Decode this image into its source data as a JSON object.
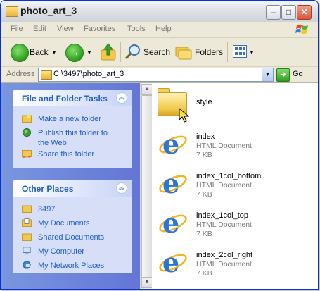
{
  "window": {
    "title": "photo_art_3"
  },
  "titlebar_buttons": {
    "minimize": "–",
    "maximize": "□",
    "close": "✕"
  },
  "menu": [
    "File",
    "Edit",
    "View",
    "Favorites",
    "Tools",
    "Help"
  ],
  "toolbar": {
    "back": "Back",
    "forward_arrow": "→",
    "back_arrow": "←",
    "search": "Search",
    "folders": "Folders"
  },
  "address": {
    "label": "Address",
    "value": "C:\\3497\\photo_art_3",
    "go": "Go"
  },
  "tasks_panel": {
    "title": "File and Folder Tasks",
    "items": [
      "Make a new folder",
      "Publish this folder to the Web",
      "Share this folder"
    ]
  },
  "places_panel": {
    "title": "Other Places",
    "items": [
      "3497",
      "My Documents",
      "Shared Documents",
      "My Computer",
      "My Network Places"
    ]
  },
  "files": [
    {
      "name": "style",
      "type": "",
      "size": "",
      "kind": "folder"
    },
    {
      "name": "index",
      "type": "HTML Document",
      "size": "7 KB",
      "kind": "html"
    },
    {
      "name": "index_1col_bottom",
      "type": "HTML Document",
      "size": "7 KB",
      "kind": "html"
    },
    {
      "name": "index_1col_top",
      "type": "HTML Document",
      "size": "7 KB",
      "kind": "html"
    },
    {
      "name": "index_2col_right",
      "type": "HTML Document",
      "size": "7 KB",
      "kind": "html"
    }
  ],
  "colors": {
    "titlebar": "#dfe1e6",
    "taskpane": "#6d85da",
    "link": "#215dc6"
  }
}
